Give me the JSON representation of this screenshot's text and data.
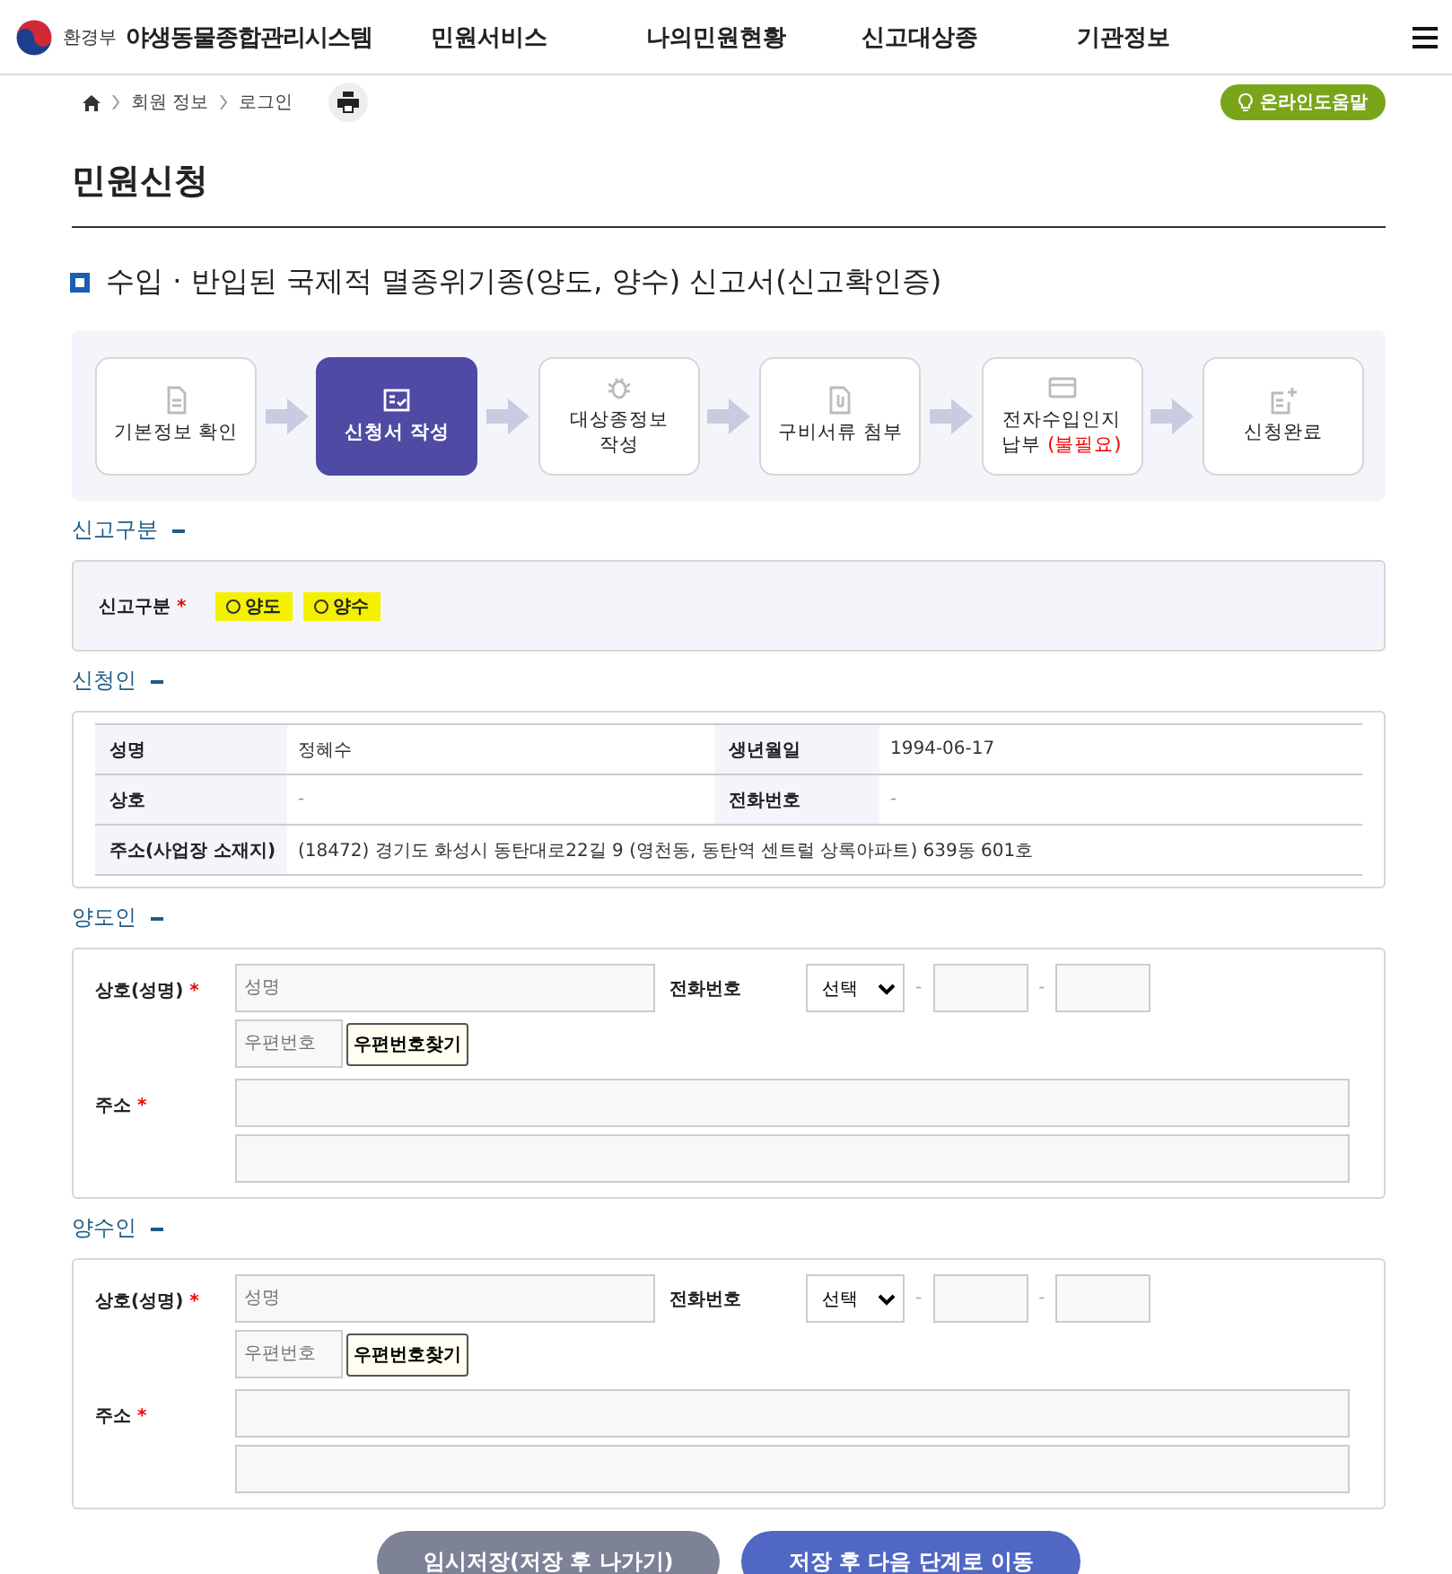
{
  "header": {
    "ministry": "환경부",
    "system_name": "야생동물종합관리시스템",
    "nav": [
      "민원서비스",
      "나의민원현황",
      "신고대상종",
      "기관정보"
    ]
  },
  "breadcrumb": {
    "items": [
      "회원 정보",
      "로그인"
    ],
    "help_button": "온라인도움말"
  },
  "page_title": "민원신청",
  "form_title": "수입 · 반입된 국제적 멸종위기종(양도, 양수) 신고서(신고확인증)",
  "steps": [
    {
      "label": "기본정보 확인",
      "selected": false
    },
    {
      "label": "신청서 작성",
      "selected": true
    },
    {
      "label": "대상종정보\n작성",
      "selected": false
    },
    {
      "label": "구비서류 첨부",
      "selected": false
    },
    {
      "label": "전자수입인지\n납부",
      "note": "(불필요)",
      "selected": false
    },
    {
      "label": "신청완료",
      "selected": false
    }
  ],
  "report_type": {
    "heading": "신고구분",
    "label": "신고구분",
    "required_mark": "*",
    "options": [
      {
        "label": "양도",
        "selected": false
      },
      {
        "label": "양수",
        "selected": false
      }
    ]
  },
  "applicant": {
    "heading": "신청인",
    "rows": [
      {
        "label_1": "성명",
        "value_1": "정혜수",
        "label_2": "생년월일",
        "value_2": "1994-06-17"
      },
      {
        "label_1": "상호",
        "value_1": "-",
        "label_2": "전화번호",
        "value_2": "-"
      },
      {
        "label_1": "주소(사업장 소재지)",
        "value_1": "(18472) 경기도 화성시 동탄대로22길 9 (영천동, 동탄역 센트럴 상록아파트) 639동 601호"
      }
    ]
  },
  "parties": [
    {
      "heading": "양도인",
      "name_label": "상호(성명)",
      "name_required_mark": "*",
      "name_placeholder": "성명",
      "phone_label": "전화번호",
      "phone_select": "선택",
      "phone_separators": [
        "-",
        "-"
      ],
      "zip_placeholder": "우편번호",
      "zip_button": "우편번호찾기",
      "address_label": "주소",
      "address_required_mark": "*"
    },
    {
      "heading": "양수인",
      "name_label": "상호(성명)",
      "name_required_mark": "*",
      "name_placeholder": "성명",
      "phone_label": "전화번호",
      "phone_select": "선택",
      "phone_separators": [
        "-",
        "-"
      ],
      "zip_placeholder": "우편번호",
      "zip_button": "우편번호찾기",
      "address_label": "주소",
      "address_required_mark": "*"
    }
  ],
  "buttons": [
    {
      "label": "임시저장(저장 후 나가기)",
      "kind": "secondary"
    },
    {
      "label": "저장 후 다음 단계로 이동",
      "kind": "primary"
    }
  ]
}
